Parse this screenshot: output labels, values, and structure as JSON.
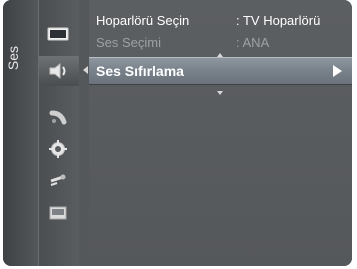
{
  "side_tab": {
    "label": "Ses"
  },
  "icons": [
    {
      "name": "tv-screen-icon"
    },
    {
      "name": "speaker-icon"
    },
    {
      "name": "satellite-dish-icon"
    },
    {
      "name": "gear-icon"
    },
    {
      "name": "input-plug-icon"
    },
    {
      "name": "application-icon"
    }
  ],
  "menu": {
    "rows": [
      {
        "label": "Hoparlörü Seçin",
        "value": ": TV Hoparlörü"
      },
      {
        "label": "Ses Seçimi",
        "value": ": ANA"
      },
      {
        "label": "Ses Sıfırlama"
      }
    ]
  },
  "colors": {
    "panel_bg": "#55585b",
    "selected_bg": "#7a838c",
    "disabled_text": "#9ea1a4",
    "text": "#ffffff"
  }
}
